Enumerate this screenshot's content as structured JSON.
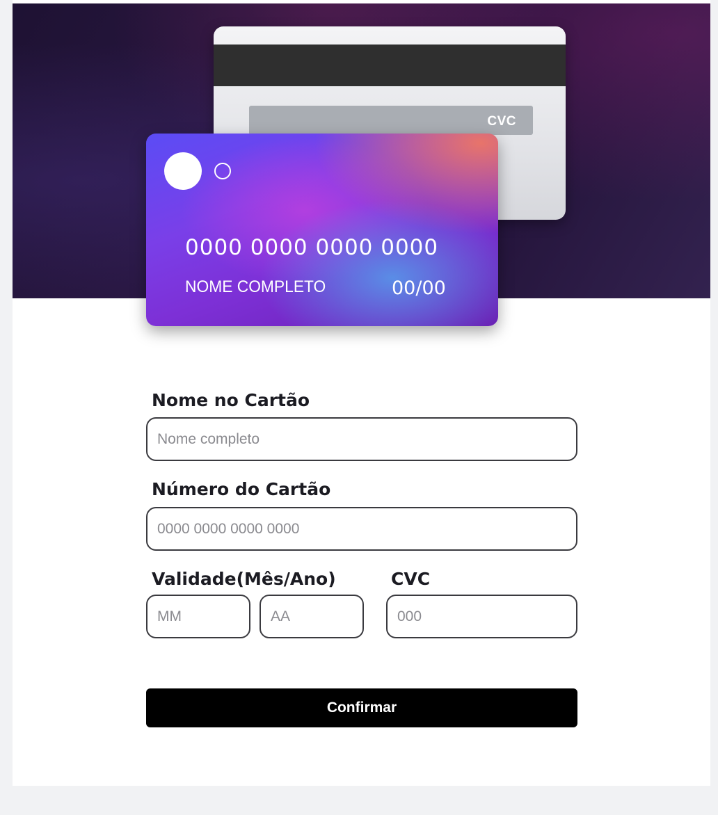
{
  "card_back": {
    "cvc_label": "CVC"
  },
  "card_front": {
    "number": "0000 0000 0000 0000",
    "holder": "NOME COMPLETO",
    "expiry": "00/00"
  },
  "form": {
    "name": {
      "label": "Nome no Cartão",
      "placeholder": "Nome completo",
      "value": ""
    },
    "number": {
      "label": "Número do Cartão",
      "placeholder": "0000 0000 0000 0000",
      "value": ""
    },
    "expiry": {
      "label": "Validade(Mês/Ano)",
      "month_placeholder": "MM",
      "year_placeholder": "AA"
    },
    "cvc": {
      "label": "CVC",
      "placeholder": "000"
    },
    "confirm_label": "Confirmar"
  },
  "colors": {
    "button_background": "#000000",
    "card_gradient_start": "#5b4cf5",
    "card_gradient_end": "#6a1fb3",
    "hero_background": "#221238"
  }
}
